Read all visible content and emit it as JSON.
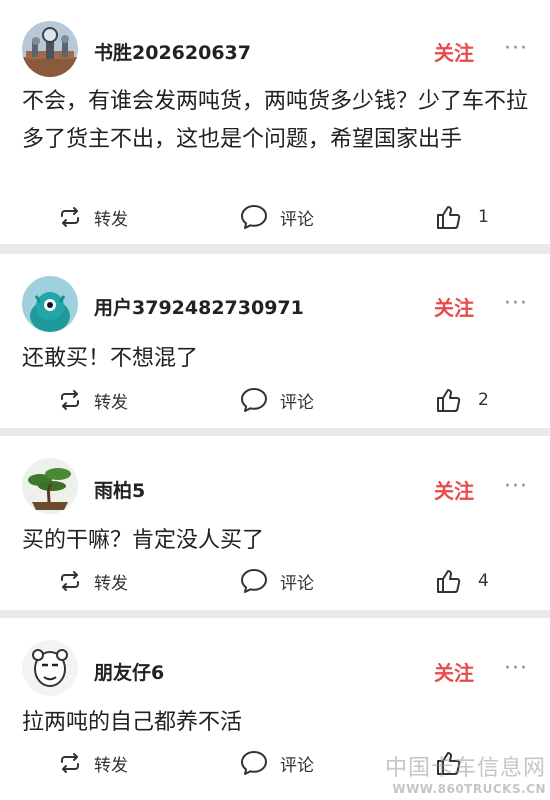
{
  "posts": [
    {
      "username": "书胜202620637",
      "follow_label": "关注",
      "more_label": "···",
      "content": "不会，有谁会发两吨货，两吨货多少钱？少了车不拉多了货主不出，这也是个问题，希望国家出手",
      "share_label": "转发",
      "comment_label": "评论",
      "like_count": "1",
      "avatar_icon": "city-clock-tower-avatar"
    },
    {
      "username": "用户3792482730971",
      "follow_label": "关注",
      "more_label": "···",
      "content": "还敢买！不想混了",
      "share_label": "转发",
      "comment_label": "评论",
      "like_count": "2",
      "avatar_icon": "teal-monster-avatar"
    },
    {
      "username": "雨柏5",
      "follow_label": "关注",
      "more_label": "···",
      "content": "买的干嘛？肯定没人买了",
      "share_label": "转发",
      "comment_label": "评论",
      "like_count": "4",
      "avatar_icon": "bonsai-tree-avatar"
    },
    {
      "username": "朋友仔6",
      "follow_label": "关注",
      "more_label": "···",
      "content": "拉两吨的自己都养不活",
      "share_label": "转发",
      "comment_label": "评论",
      "like_count": "",
      "avatar_icon": "cartoon-face-avatar"
    }
  ],
  "watermark": {
    "line1": "中国卡车信息网",
    "line2": "WWW.860TRUCKS.CN"
  },
  "colors": {
    "follow": "#e94a4a",
    "background": "#e9e9e9",
    "card": "#ffffff"
  }
}
